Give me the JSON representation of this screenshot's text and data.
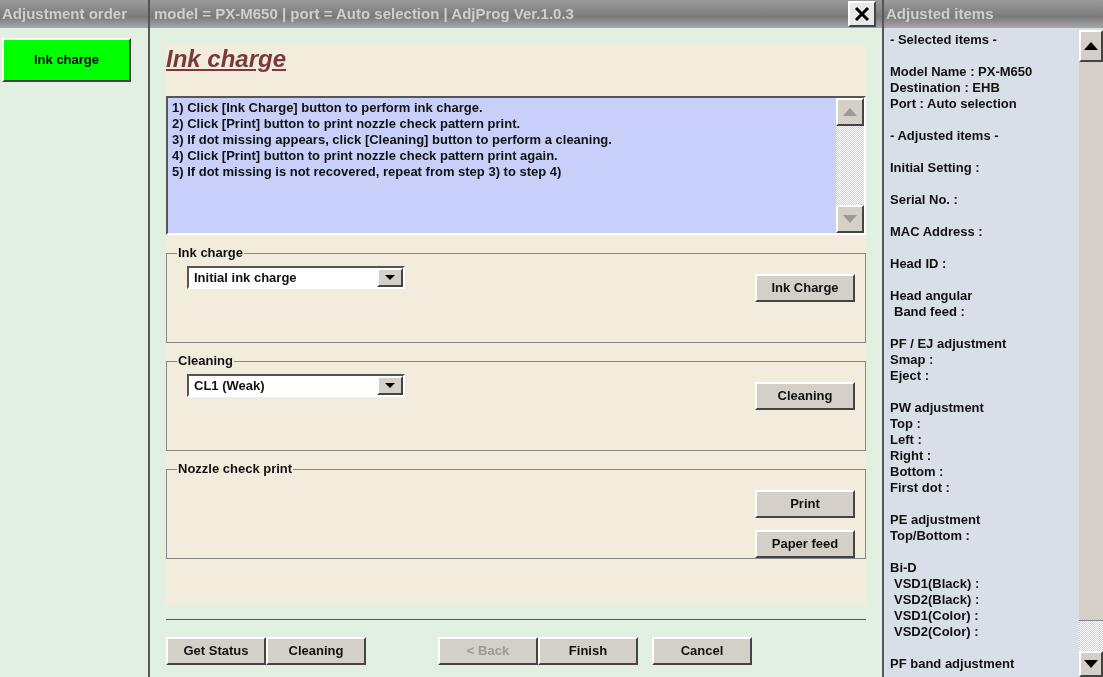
{
  "left_panel": {
    "title": "Adjustment order",
    "items": [
      {
        "label": "Ink charge",
        "selected": true
      }
    ]
  },
  "window": {
    "title": "model = PX-M650 | port = Auto selection | AdjProg Ver.1.0.3"
  },
  "page": {
    "heading": "Ink charge",
    "instructions": [
      "1) Click [Ink Charge] button to perform ink charge.",
      "2) Click [Print] button to print nozzle check pattern print.",
      "3) If dot missing appears, click [Cleaning] button to perform a cleaning.",
      "4) Click [Print] button to print nozzle check pattern print again.",
      "5) If dot missing is not recovered, repeat from step 3) to step 4)"
    ],
    "groups": [
      {
        "label": "Ink charge",
        "dropdown": "Initial ink charge",
        "buttons": [
          "Ink Charge"
        ]
      },
      {
        "label": "Cleaning",
        "dropdown": "CL1 (Weak)",
        "buttons": [
          "Cleaning"
        ]
      },
      {
        "label": "Nozzle check print",
        "buttons": [
          "Print",
          "Paper feed"
        ]
      }
    ]
  },
  "footer_buttons": [
    [
      {
        "label": "Get Status",
        "disabled": false
      },
      {
        "label": "Cleaning",
        "disabled": false
      }
    ],
    [
      {
        "label": "< Back",
        "disabled": true
      },
      {
        "label": "Finish",
        "disabled": false
      }
    ],
    [
      {
        "label": "Cancel",
        "disabled": false
      }
    ]
  ],
  "right_panel": {
    "title": "Adjusted items",
    "blocks": [
      [
        {
          "text": "- Selected items -",
          "indent": false
        }
      ],
      [
        {
          "text": "Model Name : PX-M650",
          "indent": false
        },
        {
          "text": "Destination : EHB",
          "indent": false
        },
        {
          "text": "Port : Auto selection",
          "indent": false
        }
      ],
      [
        {
          "text": "- Adjusted items -",
          "indent": false
        }
      ],
      [
        {
          "text": "Initial Setting :",
          "indent": false
        }
      ],
      [
        {
          "text": "Serial No. :",
          "indent": false
        }
      ],
      [
        {
          "text": "MAC Address :",
          "indent": false
        }
      ],
      [
        {
          "text": "Head ID :",
          "indent": false
        }
      ],
      [
        {
          "text": "Head angular",
          "indent": false
        },
        {
          "text": "Band feed :",
          "indent": true
        }
      ],
      [
        {
          "text": "PF / EJ adjustment",
          "indent": false
        },
        {
          "text": "Smap :",
          "indent": false
        },
        {
          "text": "Eject :",
          "indent": false
        }
      ],
      [
        {
          "text": "PW adjustment",
          "indent": false
        },
        {
          "text": "Top :",
          "indent": false
        },
        {
          "text": "Left :",
          "indent": false
        },
        {
          "text": "Right :",
          "indent": false
        },
        {
          "text": "Bottom :",
          "indent": false
        },
        {
          "text": "First dot :",
          "indent": false
        }
      ],
      [
        {
          "text": "PE adjustment",
          "indent": false
        },
        {
          "text": "Top/Bottom :",
          "indent": false
        }
      ],
      [
        {
          "text": "Bi-D",
          "indent": false
        },
        {
          "text": "VSD1(Black) :",
          "indent": true
        },
        {
          "text": "VSD2(Black) :",
          "indent": true
        },
        {
          "text": "VSD1(Color) :",
          "indent": true
        },
        {
          "text": "VSD2(Color) :",
          "indent": true
        }
      ],
      [
        {
          "text": "PF band adjustment",
          "indent": false
        }
      ]
    ]
  }
}
